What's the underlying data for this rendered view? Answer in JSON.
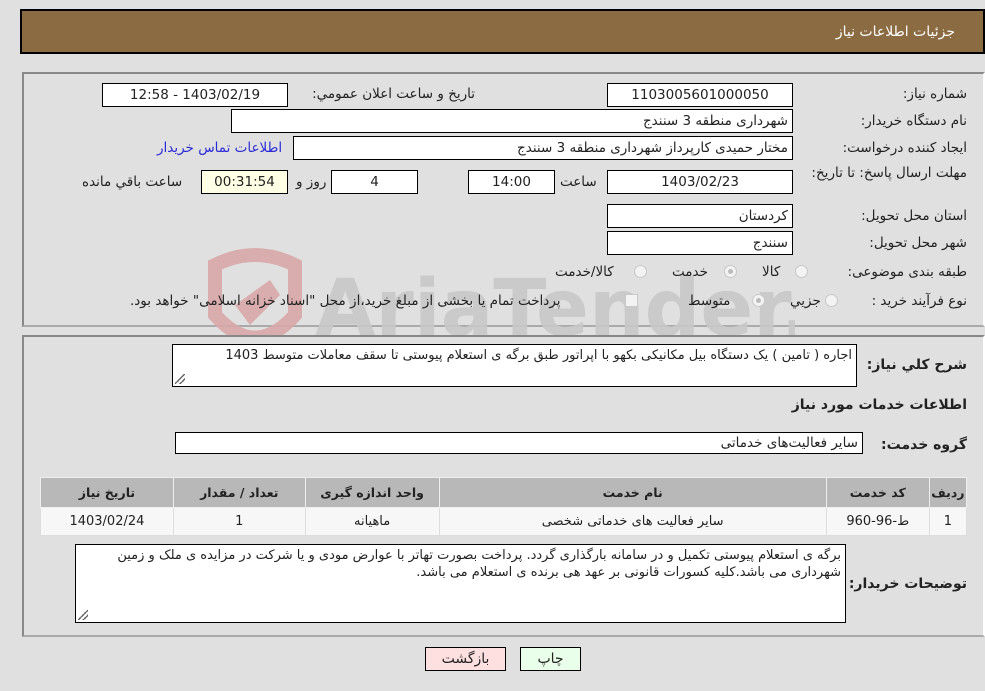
{
  "header": {
    "title": "جزئیات اطلاعات نیاز"
  },
  "fields": {
    "need_number": {
      "label": "شماره نیاز:",
      "value": "1103005601000050"
    },
    "announce_datetime": {
      "label": "تاریخ و ساعت اعلان عمومي:",
      "value": "1403/02/19 - 12:58"
    },
    "buyer_org": {
      "label": "نام دستگاه خريدار:",
      "value": "شهرداری منطقه 3 سنندج"
    },
    "requester": {
      "label": "ايجاد کننده درخواست:",
      "value": "مختار حمیدی کارپرداز شهرداری منطقه 3 سنندج",
      "contact_link": "اطلاعات تماس خريدار"
    },
    "deadline": {
      "label": "مهلت ارسال پاسخ: تا تاریخ:",
      "date": "1403/02/23",
      "time_label": "ساعت",
      "time": "14:00",
      "days": "4",
      "days_label": "روز و",
      "remaining": "00:31:54",
      "remaining_label": "ساعت باقي مانده"
    },
    "province": {
      "label": "استان محل تحویل:",
      "value": "کردستان"
    },
    "city": {
      "label": "شهر محل تحویل:",
      "value": "سنندج"
    },
    "category": {
      "label": "طبقه بندی موضوعی:",
      "options": [
        "کالا",
        "خدمت",
        "کالا/خدمت"
      ],
      "selected": "خدمت"
    },
    "purchase_type": {
      "label": "نوع فرآیند خرید :",
      "options": [
        "جزيي",
        "متوسط"
      ],
      "selected": "متوسط",
      "treasury_note": "پرداخت تمام يا بخشی از مبلغ خريد،از محل \"اسناد خزانه اسلامی\" خواهد بود."
    }
  },
  "description": {
    "label": "شرح کلي نياز:",
    "value": "اجاره ( تامین ) یک دستگاه بیل مکانیکی بکهو با اپراتور  طبق برگه ی استعلام پیوستی تا سقف معاملات متوسط 1403"
  },
  "services_section": {
    "title": "اطلاعات خدمات مورد نياز",
    "group_label": "گروه خدمت:",
    "group_value": "سایر فعالیت‌های خدماتی"
  },
  "table": {
    "headers": [
      "رديف",
      "کد خدمت",
      "نام خدمت",
      "واحد اندازه گيری",
      "تعداد / مقدار",
      "تاريخ نياز"
    ],
    "rows": [
      [
        "1",
        "ط-96-960",
        "سایر فعالیت های خدماتی شخصی",
        "ماهیانه",
        "1",
        "1403/02/24"
      ]
    ]
  },
  "buyer_notes": {
    "label": "توضيحات خريدار:",
    "value": "برگه ی استعلام پیوستی تکمیل و در سامانه بارگذاری گردد. پرداخت بصورت تهاتر با عوارض مودی و یا شرکت در مزایده ی ملک و زمین شهرداری می باشد.کلیه کسورات قانونی بر عهد هی برنده ی استعلام می باشد."
  },
  "buttons": {
    "print": "چاپ",
    "back": "بازگشت"
  },
  "watermark": {
    "text": "AriaTender.neT"
  },
  "colors": {
    "header_bg": "#8b6b42",
    "print_bg": "#eaffea",
    "back_bg": "#ffe0e0",
    "link": "#2a2ad8",
    "remaining_bg": "#ffffe6"
  }
}
